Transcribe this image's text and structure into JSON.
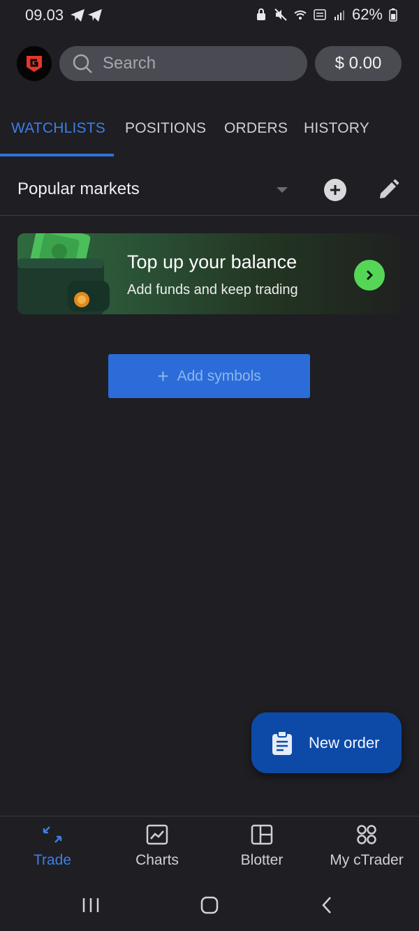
{
  "status_bar": {
    "time": "09.03",
    "battery": "62%"
  },
  "header": {
    "search_placeholder": "Search",
    "balance": "$ 0.00"
  },
  "tabs": [
    {
      "label": "WATCHLISTS",
      "active": true
    },
    {
      "label": "POSITIONS",
      "active": false
    },
    {
      "label": "ORDERS",
      "active": false
    },
    {
      "label": "HISTORY",
      "active": false
    }
  ],
  "watchlist": {
    "title": "Popular markets"
  },
  "banner": {
    "title": "Top up your balance",
    "subtitle": "Add funds and keep trading"
  },
  "add_symbols": {
    "label": "Add symbols"
  },
  "fab": {
    "label": "New order"
  },
  "bottom_nav": [
    {
      "label": "Trade",
      "icon": "trade-icon",
      "active": true
    },
    {
      "label": "Charts",
      "icon": "charts-icon",
      "active": false
    },
    {
      "label": "Blotter",
      "icon": "blotter-icon",
      "active": false
    },
    {
      "label": "My cTrader",
      "icon": "my-ctrader-icon",
      "active": false
    }
  ],
  "colors": {
    "background": "#1e1e23",
    "accent": "#2f73d9",
    "fab": "#0d4aa8",
    "banner_action": "#56d657"
  }
}
